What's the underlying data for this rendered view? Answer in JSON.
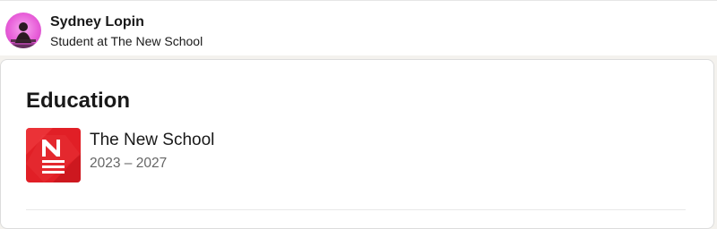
{
  "profile_bar": {
    "name": "Sydney Lopin",
    "headline": "Student at The New School",
    "avatar_icon": "profile-photo"
  },
  "education": {
    "title": "Education",
    "items": [
      {
        "school": "The New School",
        "dates": "2023 – 2027",
        "logo_icon": "new-school-n-logo"
      }
    ]
  },
  "colors": {
    "logo_red": "#e11f26",
    "avatar_pink": "#e85fd9",
    "secondary_text": "#666666"
  }
}
